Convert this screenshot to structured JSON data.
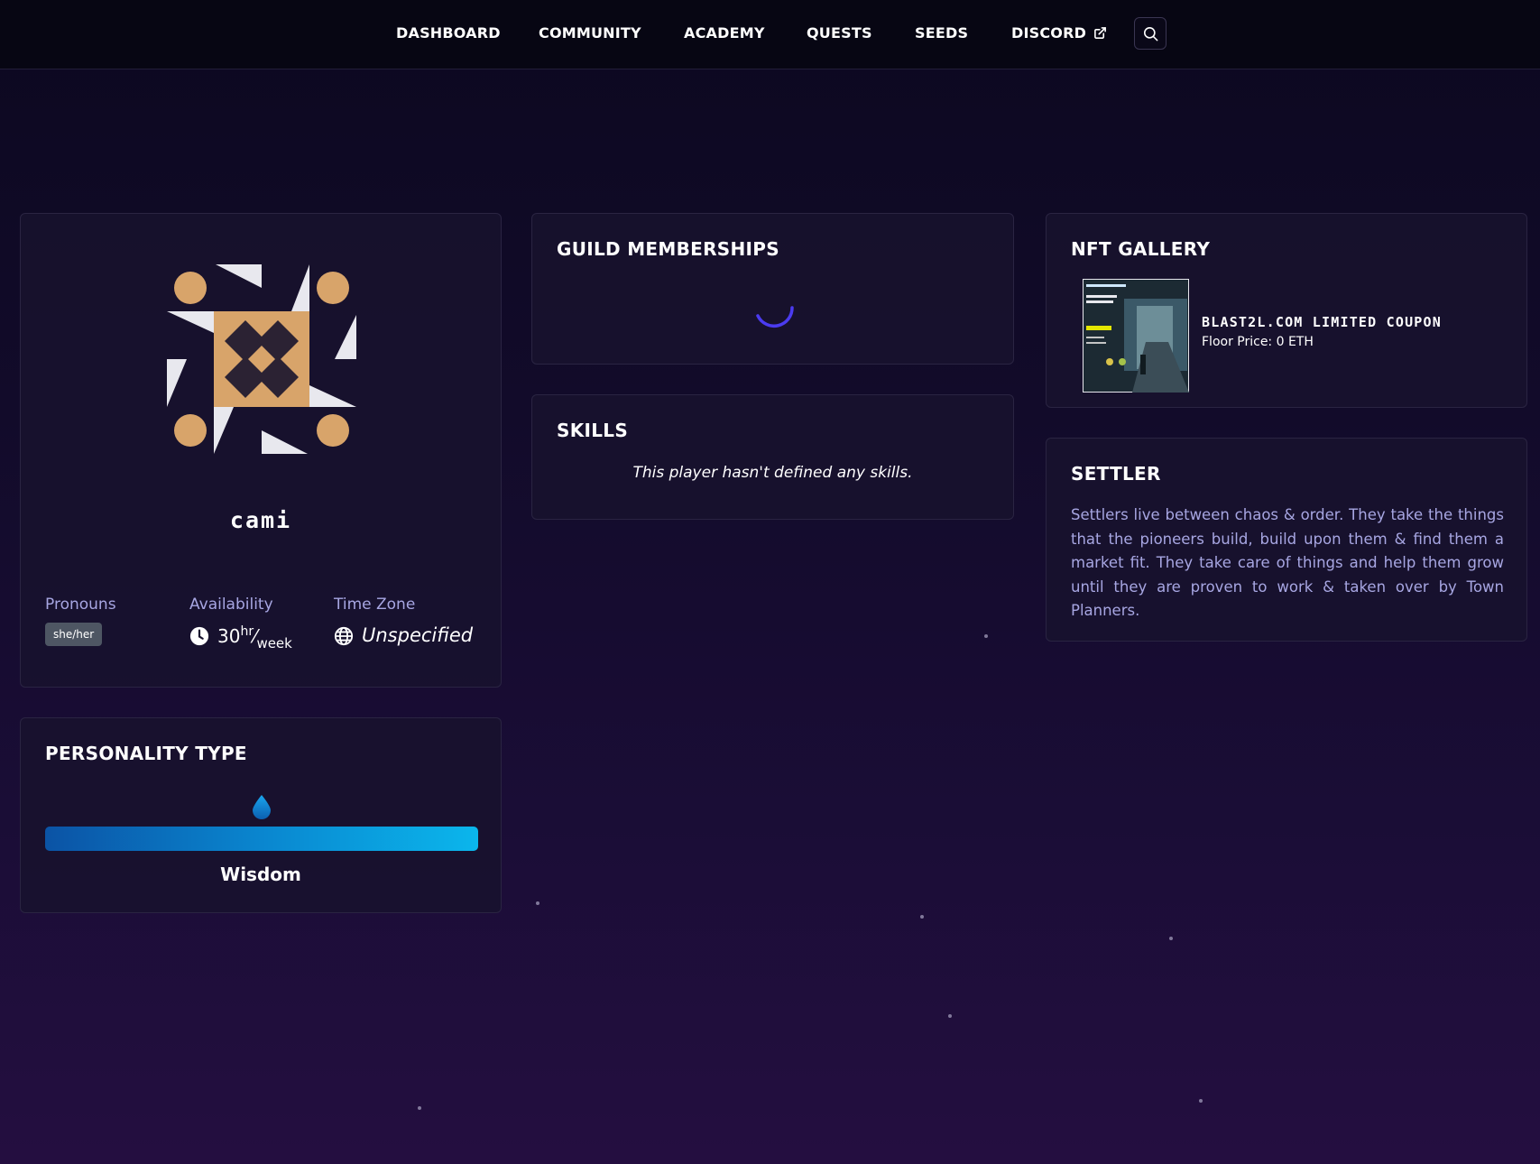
{
  "nav": {
    "items": [
      {
        "label": "DASHBOARD"
      },
      {
        "label": "COMMUNITY"
      },
      {
        "label": "ACADEMY"
      },
      {
        "label": "QUESTS"
      },
      {
        "label": "SEEDS"
      },
      {
        "label": "DISCORD",
        "icon": "external-link-icon"
      }
    ],
    "search_icon": "search-icon"
  },
  "profile": {
    "username": "cami",
    "avatar_icon": "identicon-avatar",
    "avatar_colors": [
      "#d8a46a",
      "#2b2233",
      "#e8e8ee"
    ],
    "pronouns_label": "Pronouns",
    "pronouns": "she/her",
    "availability_label": "Availability",
    "availability_value": "30",
    "availability_unit_top": "hr",
    "availability_unit_bottom": "week",
    "availability_icon": "clock-icon",
    "timezone_label": "Time Zone",
    "timezone_value": "Unspecified",
    "timezone_icon": "globe-icon"
  },
  "personality": {
    "title": "PERSONALITY TYPE",
    "icon": "water-drop-icon",
    "value": "Wisdom",
    "colors": [
      "#0b53a5",
      "#0bb6ec"
    ]
  },
  "guilds": {
    "title": "GUILD MEMBERSHIPS",
    "loading_icon": "loading-spinner-icon"
  },
  "skills": {
    "title": "SKILLS",
    "empty_text": "This player hasn't defined any skills."
  },
  "nft_gallery": {
    "title": "NFT GALLERY",
    "items": [
      {
        "name": "BLAST2L.COM LIMITED COUPON",
        "price": "Floor Price: 0 ETH",
        "thumbnail_icon": "nft-thumbnail"
      }
    ]
  },
  "role": {
    "title": "SETTLER",
    "description": "Settlers live between chaos & order. They take the things that the pioneers build, build upon them & find them a market fit. They take care of things and help them grow until they are proven to work & taken over by Town Planners."
  },
  "colors": {
    "background": "#120b2a",
    "card": "#18122e",
    "accent_text": "#a7a6e2",
    "spinner": "#4b3bf0"
  }
}
